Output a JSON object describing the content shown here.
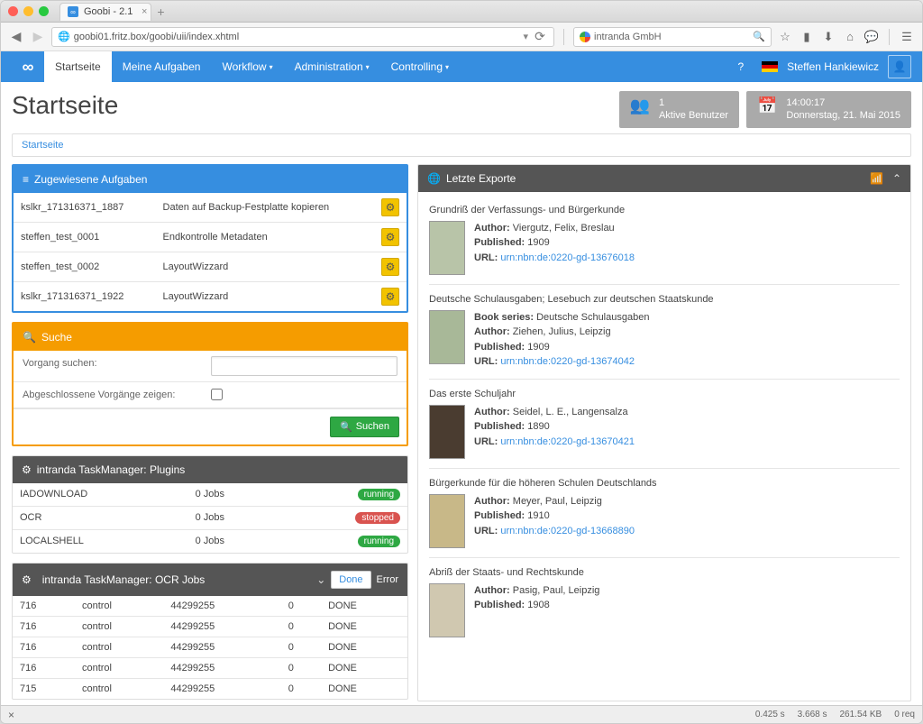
{
  "browser": {
    "tabTitle": "Goobi - 2.1",
    "url": "goobi01.fritz.box/goobi/uii/index.xhtml",
    "searchPlaceholder": "intranda GmbH"
  },
  "nav": {
    "items": [
      "Startseite",
      "Meine Aufgaben",
      "Workflow",
      "Administration",
      "Controlling"
    ],
    "user": "Steffen Hankiewicz"
  },
  "header": {
    "title": "Startseite",
    "activeUsersCount": "1",
    "activeUsersLabel": "Aktive Benutzer",
    "time": "14:00:17",
    "date": "Donnerstag, 21. Mai 2015"
  },
  "breadcrumb": "Startseite",
  "tasks": {
    "title": "Zugewiesene Aufgaben",
    "rows": [
      {
        "id": "kslkr_171316371_1887",
        "task": "Daten auf Backup-Festplatte kopieren"
      },
      {
        "id": "steffen_test_0001",
        "task": "Endkontrolle Metadaten"
      },
      {
        "id": "steffen_test_0002",
        "task": "LayoutWizzard"
      },
      {
        "id": "kslkr_171316371_1922",
        "task": "LayoutWizzard"
      }
    ]
  },
  "search": {
    "title": "Suche",
    "labelSearch": "Vorgang suchen:",
    "labelClosed": "Abgeschlossene Vorgänge zeigen:",
    "button": "Suchen"
  },
  "plugins": {
    "title": "intranda TaskManager: Plugins",
    "rows": [
      {
        "name": "IADOWNLOAD",
        "jobs": "0 Jobs",
        "status": "running"
      },
      {
        "name": "OCR",
        "jobs": "0 Jobs",
        "status": "stopped"
      },
      {
        "name": "LOCALSHELL",
        "jobs": "0 Jobs",
        "status": "running"
      }
    ]
  },
  "ocr": {
    "title": "intranda TaskManager: OCR Jobs",
    "dropdown": "Done",
    "errorLabel": "Error",
    "rows": [
      {
        "a": "716",
        "b": "control",
        "c": "44299255",
        "d": "0",
        "e": "DONE"
      },
      {
        "a": "716",
        "b": "control",
        "c": "44299255",
        "d": "0",
        "e": "DONE"
      },
      {
        "a": "716",
        "b": "control",
        "c": "44299255",
        "d": "0",
        "e": "DONE"
      },
      {
        "a": "716",
        "b": "control",
        "c": "44299255",
        "d": "0",
        "e": "DONE"
      },
      {
        "a": "715",
        "b": "control",
        "c": "44299255",
        "d": "0",
        "e": "DONE"
      }
    ]
  },
  "exports": {
    "title": "Letzte Exporte",
    "items": [
      {
        "title": "Grundriß der Verfassungs- und Bürgerkunde",
        "author": "Viergutz, Felix, Breslau",
        "published": "1909",
        "url": "urn:nbn:de:0220-gd-13676018",
        "thumb": "t1"
      },
      {
        "title": "Deutsche Schulausgaben; Lesebuch zur deutschen Staatskunde",
        "series": "Deutsche Schulausgaben",
        "author": "Ziehen, Julius, Leipzig",
        "published": "1909",
        "url": "urn:nbn:de:0220-gd-13674042",
        "thumb": "t2"
      },
      {
        "title": "Das erste Schuljahr",
        "author": "Seidel, L. E., Langensalza",
        "published": "1890",
        "url": "urn:nbn:de:0220-gd-13670421",
        "thumb": "t3"
      },
      {
        "title": "Bürgerkunde für die höheren Schulen Deutschlands",
        "author": "Meyer, Paul, Leipzig",
        "published": "1910",
        "url": "urn:nbn:de:0220-gd-13668890",
        "thumb": "t4"
      },
      {
        "title": "Abriß der Staats- und Rechtskunde",
        "author": "Pasig, Paul, Leipzig",
        "published": "1908",
        "url": "",
        "thumb": "t5"
      }
    ],
    "labels": {
      "author": "Author:",
      "published": "Published:",
      "url": "URL:",
      "series": "Book series:"
    }
  },
  "statusbar": {
    "time": "0.425 s",
    "total": "3.668 s",
    "size": "261.54 KB",
    "req": "0 req"
  }
}
